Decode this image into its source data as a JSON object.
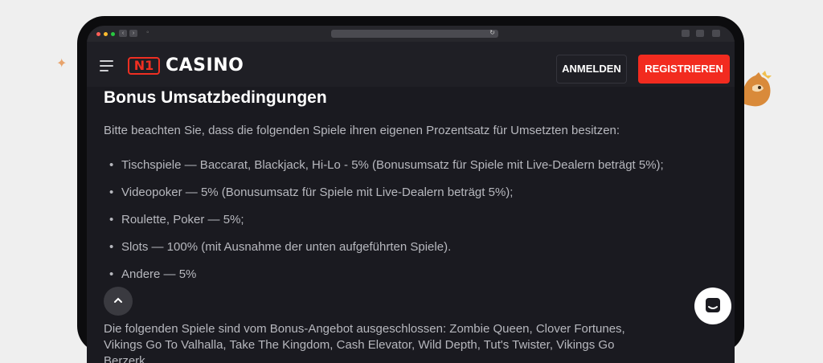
{
  "header": {
    "logo_badge": "N1",
    "logo_text": "CASINO",
    "login_label": "ANMELDEN",
    "register_label": "REGISTRIEREN"
  },
  "content": {
    "title": "Bonus Umsatzbedingungen",
    "intro": "Bitte beachten Sie, dass die folgenden Spiele ihren eigenen Prozentsatz für Umsetzten besitzen:",
    "items": [
      "Tischspiele — Baccarat, Blackjack, Hi-Lo - 5% (Bonusumsatz für Spiele mit Live-Dealern beträgt 5%);",
      "Videopoker — 5% (Bonusumsatz für Spiele mit Live-Dealern beträgt 5%);",
      "Roulette, Poker — 5%;",
      "Slots — 100% (mit Ausnahme der unten aufgeführten Spiele).",
      "Andere — 5%"
    ],
    "excluded": "Die folgenden Spiele sind vom Bonus-Angebot ausgeschlossen: Zombie Queen, Clover Fortunes, Vikings Go To Valhalla, Take The Kingdom, Cash Elevator, Wild Depth, Tut's Twister, Vikings Go Berzerk"
  },
  "icons": {
    "menu": "hamburger-menu-icon",
    "scroll_top": "chevron-up-icon",
    "chat": "chat-icon",
    "sparkle": "sparkle-icon"
  },
  "colors": {
    "page_bg": "#efefef",
    "device": "#0c0c0e",
    "screen_bg": "#1a1a20",
    "header_bg": "#1f1f25",
    "brand_red": "#f22b1f",
    "text": "#b7b8be"
  }
}
